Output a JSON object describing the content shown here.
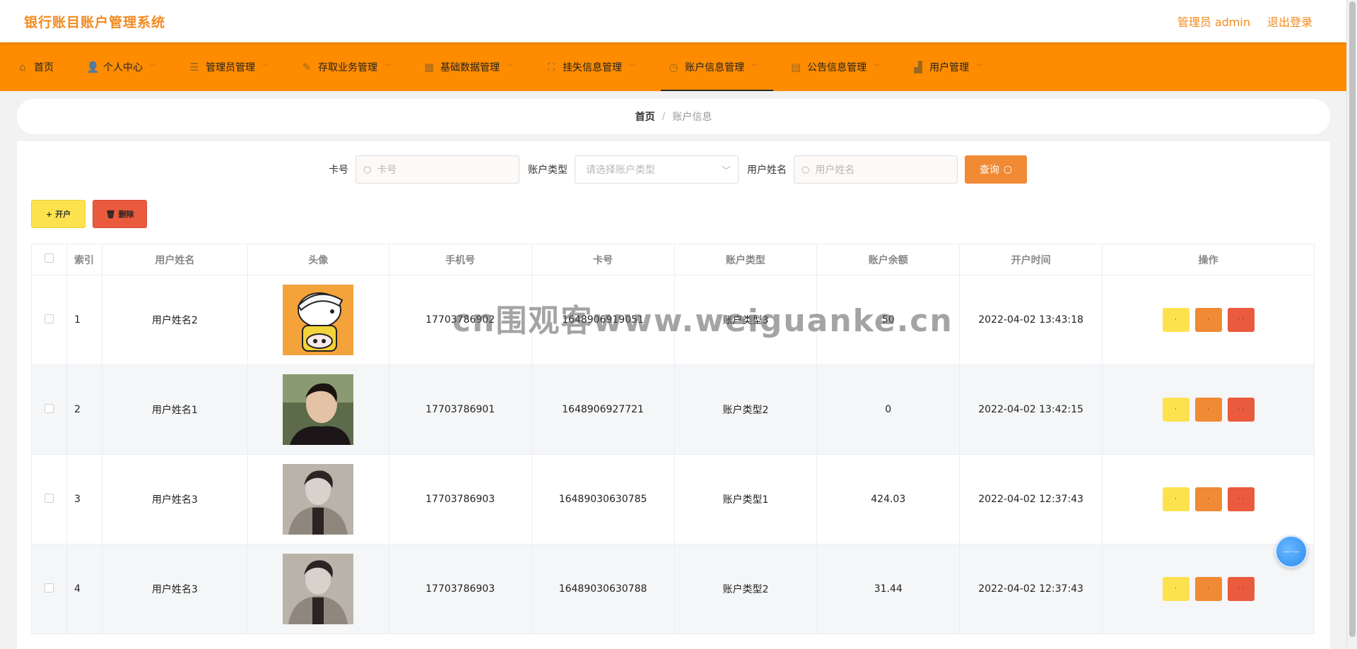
{
  "app": {
    "title": "银行账目账户管理系统"
  },
  "header": {
    "user": "管理员 admin",
    "logout": "退出登录"
  },
  "nav": {
    "items": [
      {
        "label": "首页",
        "icon": "home-icon"
      },
      {
        "label": "个人中心",
        "icon": "user-icon"
      },
      {
        "label": "管理员管理",
        "icon": "list-icon"
      },
      {
        "label": "存取业务管理",
        "icon": "edit-icon"
      },
      {
        "label": "基础数据管理",
        "icon": "grid-icon"
      },
      {
        "label": "挂失信息管理",
        "icon": "fullscreen-icon"
      },
      {
        "label": "账户信息管理",
        "icon": "clock-icon"
      },
      {
        "label": "公告信息管理",
        "icon": "clipboard-icon"
      },
      {
        "label": "用户管理",
        "icon": "chart-icon"
      }
    ],
    "active": "账户信息管理"
  },
  "breadcrumb": {
    "home": "首页",
    "sep": "/",
    "current": "账户信息"
  },
  "search": {
    "card_label": "卡号",
    "card_placeholder": "卡号",
    "type_label": "账户类型",
    "type_placeholder": "请选择账户类型",
    "name_label": "用户姓名",
    "name_placeholder": "用户姓名",
    "button": "查询"
  },
  "actions": {
    "open": "开户",
    "delete": "删除"
  },
  "table": {
    "headers": [
      "索引",
      "用户姓名",
      "头像",
      "手机号",
      "卡号",
      "账户类型",
      "账户余额",
      "开户时间",
      "操作"
    ],
    "rows": [
      {
        "index": "1",
        "name": "用户姓名2",
        "phone": "17703786902",
        "card": "1648906919051",
        "type": "账户类型3",
        "balance": "50",
        "time": "2022-04-02 13:43:18"
      },
      {
        "index": "2",
        "name": "用户姓名1",
        "phone": "17703786901",
        "card": "1648906927721",
        "type": "账户类型2",
        "balance": "0",
        "time": "2022-04-02 13:42:15"
      },
      {
        "index": "3",
        "name": "用户姓名3",
        "phone": "17703786903",
        "card": "16489030630785",
        "type": "账户类型1",
        "balance": "424.03",
        "time": "2022-04-02 12:37:43"
      },
      {
        "index": "4",
        "name": "用户姓名3",
        "phone": "17703786903",
        "card": "16489030630788",
        "type": "账户类型2",
        "balance": "31.44",
        "time": "2022-04-02 12:37:43"
      }
    ]
  },
  "watermark": "cn围观客www.weiguanke.cn",
  "colors": {
    "accent": "#ff8c00",
    "title": "#f38a1c",
    "yellow": "#fde24f",
    "orange": "#f08a35",
    "red": "#ea5a3c"
  }
}
